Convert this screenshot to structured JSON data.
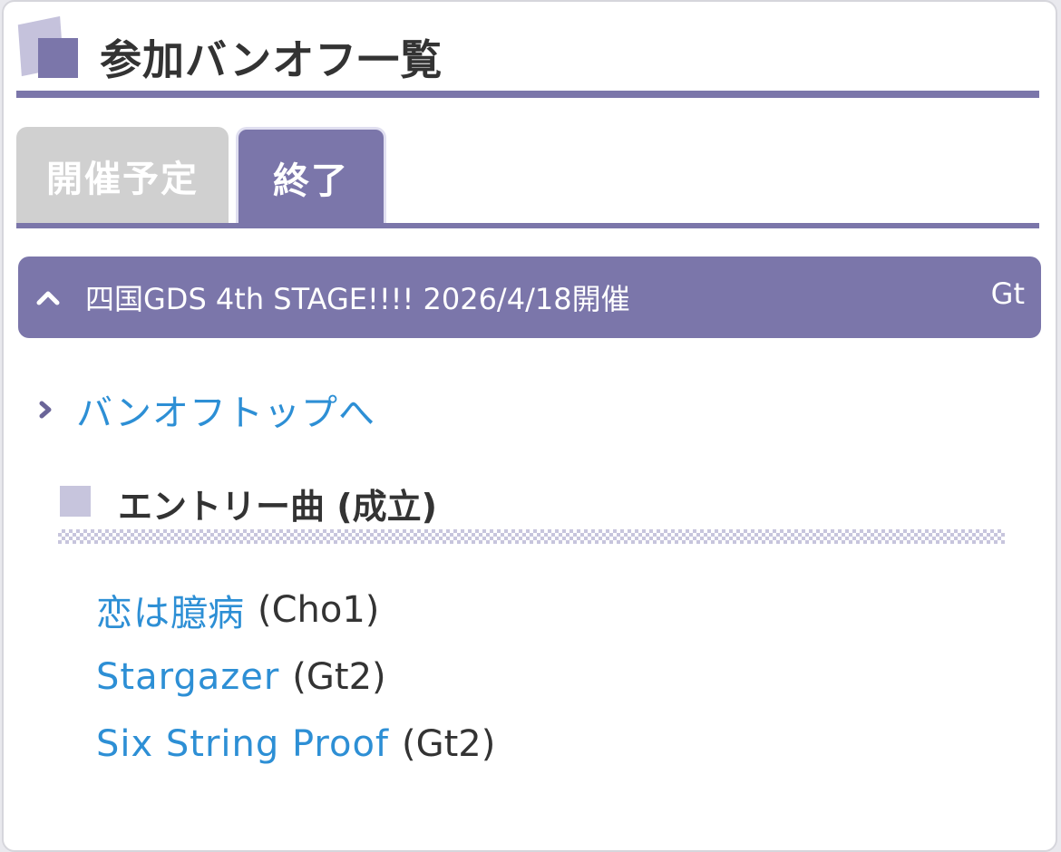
{
  "header": {
    "title": "参加バンオフ一覧"
  },
  "tabs": [
    {
      "label": "開催予定",
      "active": false
    },
    {
      "label": "終了",
      "active": true
    }
  ],
  "event": {
    "title": "四国GDS 4th STAGE!!!! 2026/4/18開催",
    "part": "Gt",
    "expand_icon": "chevron-up-icon"
  },
  "toplink": {
    "label": "バンオフトップへ",
    "icon": "chevron-right-icon"
  },
  "section": {
    "title": "エントリー曲 (成立)"
  },
  "songs": [
    {
      "name": "恋は臆病",
      "part": "(Cho1)"
    },
    {
      "name": "Stargazer",
      "part": "(Gt2)"
    },
    {
      "name": "Six String Proof",
      "part": "(Gt2)"
    }
  ],
  "colors": {
    "accent": "#7b76aa",
    "link": "#2d8fd5",
    "inactive_tab": "#d0d0d0",
    "light_accent": "#c7c5dd"
  }
}
